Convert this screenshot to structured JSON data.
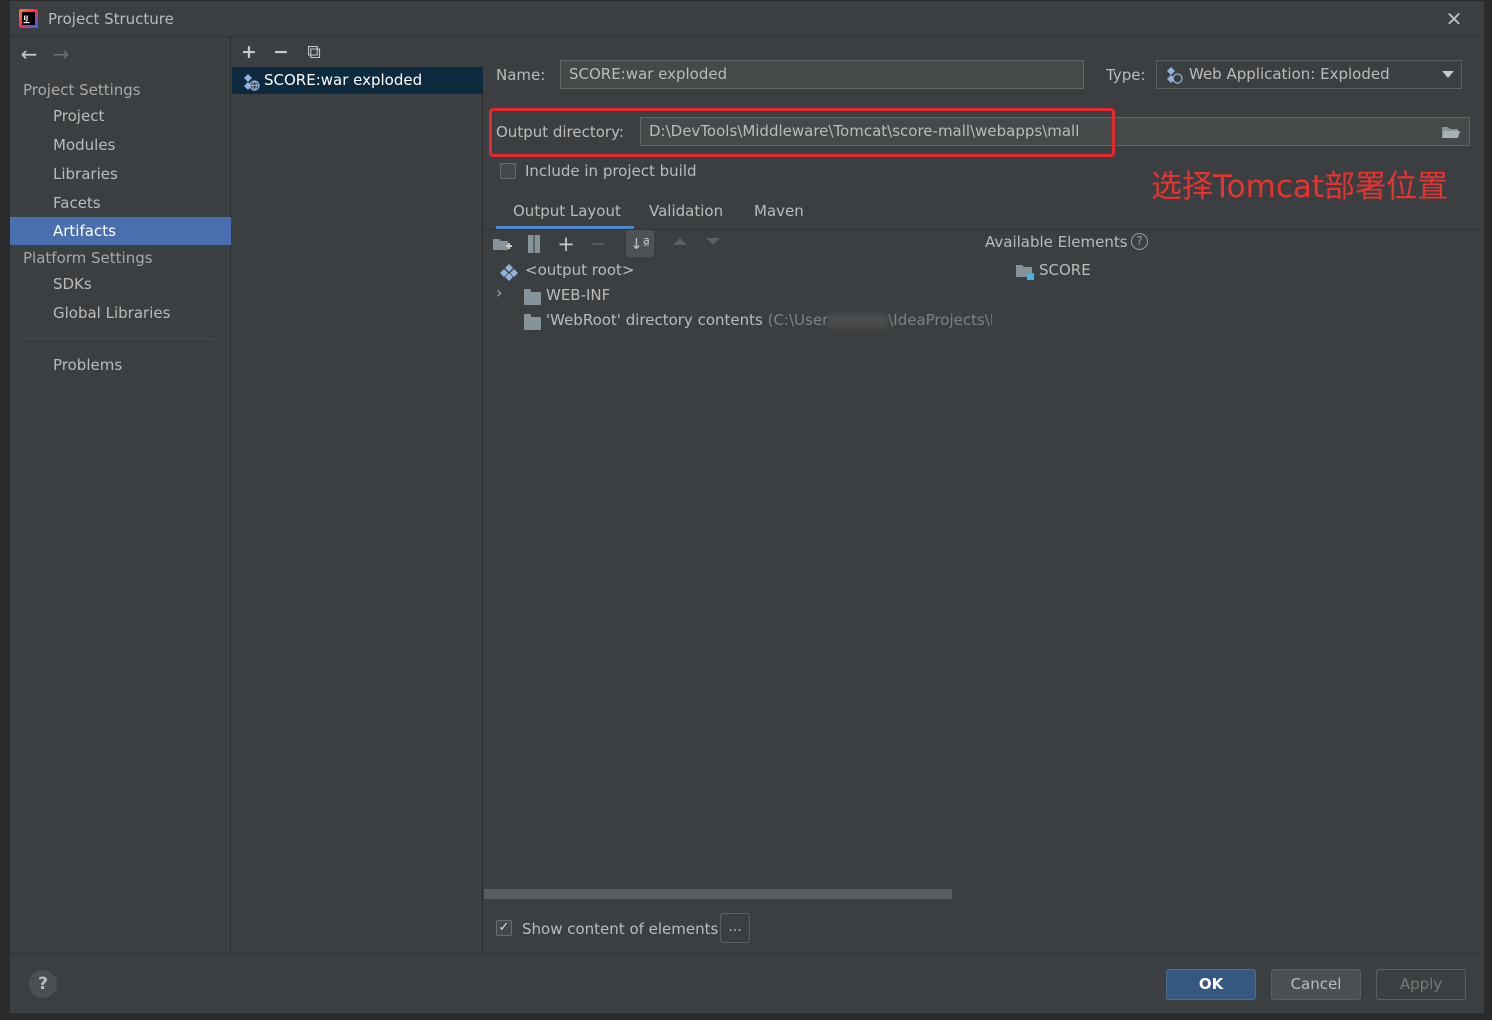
{
  "window": {
    "title": "Project Structure",
    "close_glyph": "✕"
  },
  "nav": {
    "back_glyph": "←",
    "forward_glyph": "→",
    "project_settings_header": "Project Settings",
    "project_settings_items": [
      {
        "label": "Project",
        "selected": false
      },
      {
        "label": "Modules",
        "selected": false
      },
      {
        "label": "Libraries",
        "selected": false
      },
      {
        "label": "Facets",
        "selected": false
      },
      {
        "label": "Artifacts",
        "selected": true
      }
    ],
    "platform_settings_header": "Platform Settings",
    "platform_settings_items": [
      {
        "label": "SDKs"
      },
      {
        "label": "Global Libraries"
      }
    ],
    "problems_label": "Problems"
  },
  "artifacts": {
    "toolbar": {
      "add": "+",
      "remove": "−",
      "copy": "⧉"
    },
    "items": [
      {
        "label": "SCORE:war exploded",
        "selected": true
      }
    ]
  },
  "details": {
    "name_label": "Name:",
    "name_value": "SCORE:war exploded",
    "type_label": "Type:",
    "type_value": "Web Application: Exploded",
    "output_dir_label": "Output directory:",
    "output_dir_value": "D:\\DevTools\\Middleware\\Tomcat\\score-mall\\webapps\\mall",
    "include_build_label": "Include in project build",
    "include_build_checked": false,
    "annotation": "选择Tomcat部署位置",
    "annotation_color": "#e8322e",
    "tabs": [
      {
        "label": "Output Layout",
        "active": true
      },
      {
        "label": "Validation",
        "active": false
      },
      {
        "label": "Maven",
        "active": false
      }
    ],
    "layout_tree": [
      {
        "label": "<output root>",
        "icon": "artifact-root-icon"
      },
      {
        "label": "WEB-INF",
        "icon": "folder-icon",
        "expandable": true
      },
      {
        "label": "'WebRoot' directory contents",
        "suffix": "(C:\\User",
        "suffix2": "\\IdeaProjects\\M",
        "icon": "folder-icon"
      }
    ],
    "available_elements_label": "Available Elements",
    "available_elements": [
      {
        "label": "SCORE",
        "icon": "module-folder-icon"
      }
    ],
    "show_content_label": "Show content of elements",
    "show_content_checked": true,
    "dots_label": "..."
  },
  "buttons": {
    "help": "?",
    "ok": "OK",
    "cancel": "Cancel",
    "apply": "Apply"
  },
  "colors": {
    "selection": "#4b6eaf",
    "highlight_box": "#e5282b",
    "ok_button": "#365880"
  }
}
